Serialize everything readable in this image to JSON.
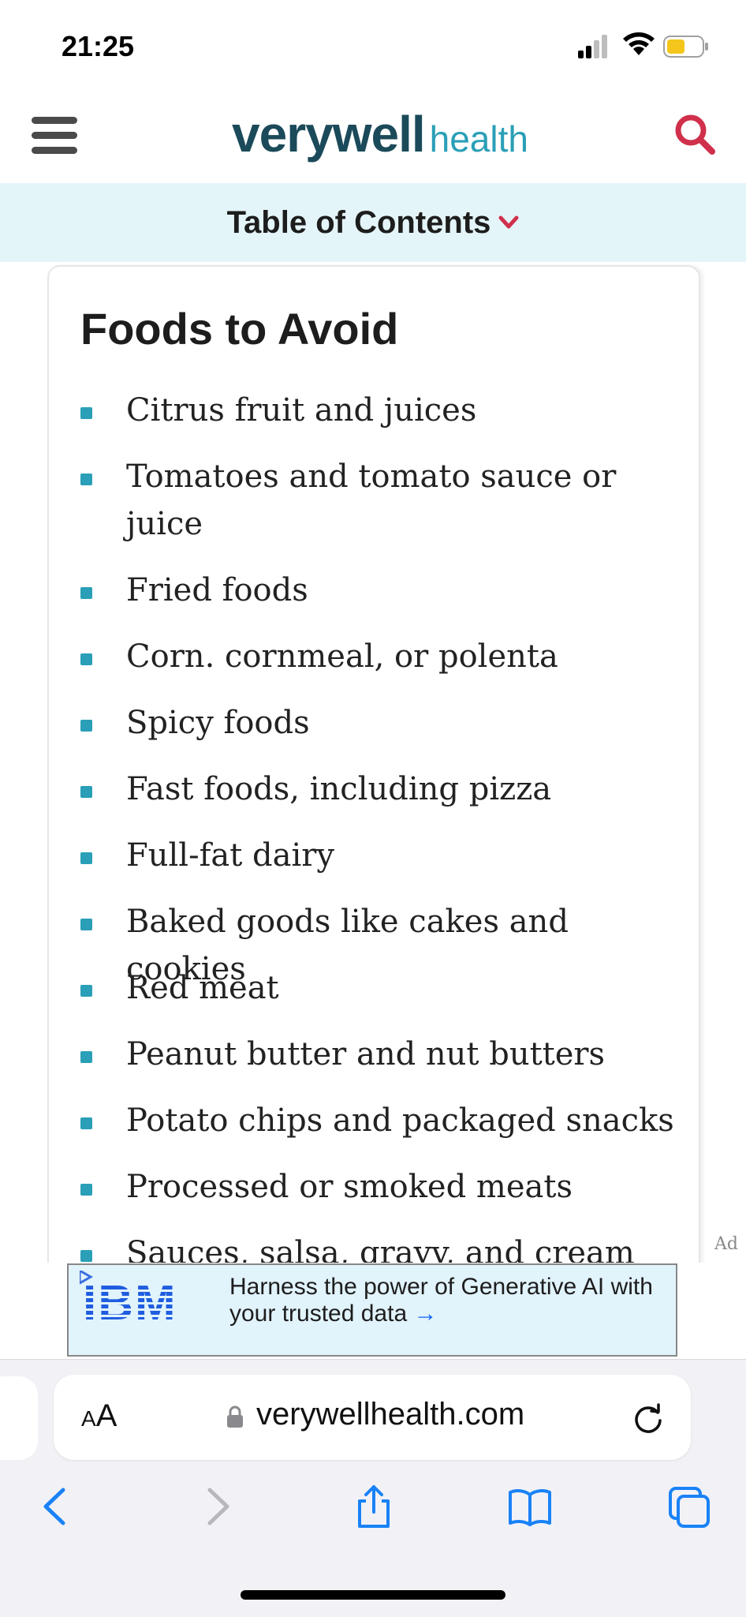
{
  "status_bar": {
    "time": "21:25"
  },
  "header": {
    "logo_primary": "verywell",
    "logo_secondary": "health"
  },
  "toc": {
    "label": "Table of Contents"
  },
  "section": {
    "title": "Foods to Avoid",
    "items": [
      "Citrus fruit and juices",
      "Tomatoes and tomato sauce or juice",
      "Fried foods",
      "Corn. cornmeal, or polenta",
      "Spicy foods",
      "Fast foods, including pizza",
      "Full-fat dairy",
      "Baked goods like cakes and cookies",
      "Red meat",
      "Peanut butter and nut butters",
      "Potato chips and packaged snacks",
      "Processed or smoked meats",
      "Sauces, salsa, gravy, and cream"
    ]
  },
  "ad": {
    "label": "Ad",
    "brand": "IBM",
    "text": "Harness the power of Generative AI with your trusted data",
    "arrow": "→"
  },
  "browser": {
    "aa_small": "A",
    "aa_large": "A",
    "url": "verywellhealth.com"
  },
  "colors": {
    "accent": "#2a9fb7",
    "brand_dark": "#1b4a5a",
    "search_red": "#d0304b",
    "toc_bg": "#e4f5f9",
    "ios_blue": "#1a82f7"
  }
}
